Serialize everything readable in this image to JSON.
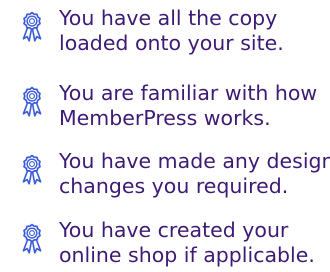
{
  "checklist": {
    "items": [
      {
        "icon": "award-badge-icon",
        "line_1": "You have all the copy",
        "line_2": "loaded onto your site."
      },
      {
        "icon": "award-badge-icon",
        "line_1": "You are familiar with how",
        "line_2": "MemberPress works."
      },
      {
        "icon": "award-badge-icon",
        "line_1": "You have made any design",
        "line_2": "changes you required."
      },
      {
        "icon": "award-badge-icon",
        "line_1": "You have created your",
        "line_2": "online shop if applicable."
      }
    ]
  },
  "colors": {
    "text": "#3d1b74",
    "icon": "#3a5bd9",
    "background": "#ffffff"
  }
}
